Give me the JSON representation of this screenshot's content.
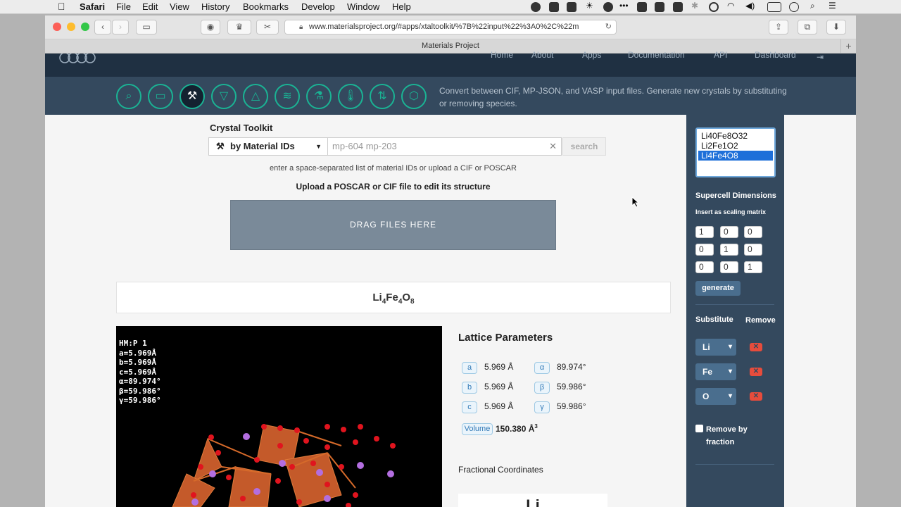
{
  "menubar": {
    "apple": "",
    "app": "Safari",
    "items": [
      "File",
      "Edit",
      "View",
      "History",
      "Bookmarks",
      "Develop",
      "Window",
      "Help"
    ]
  },
  "browser": {
    "url": "www.materialsproject.org/#apps/xtaltoolkit/%7B%22input%22%3A0%2C%22m",
    "tab_title": "Materials Project"
  },
  "site_nav": {
    "items": [
      "Home",
      "About",
      "Apps",
      "Documentation",
      "API",
      "Dashboard"
    ]
  },
  "app_toolbar": {
    "icons": [
      "search-icon",
      "battery-icon",
      "tools-icon",
      "phase-icon",
      "diagram-icon",
      "bands-icon",
      "flask-icon",
      "thermometer-icon",
      "exchange-icon",
      "structure-icon"
    ],
    "description": "Convert between CIF, MP-JSON, and VASP input files. Generate new crystals by substituting or removing species."
  },
  "toolkit": {
    "title": "Crystal Toolkit",
    "dropdown_label": "by Material IDs",
    "search_placeholder": "mp-604 mp-203",
    "search_button": "search",
    "hint": "enter a space-separated list of material IDs or upload a CIF or POSCAR",
    "upload_title": "Upload a POSCAR or CIF file to edit its structure",
    "drop_label": "DRAG FILES HERE"
  },
  "structure": {
    "formula_elements": [
      {
        "el": "Li",
        "n": "4"
      },
      {
        "el": "Fe",
        "n": "4"
      },
      {
        "el": "O",
        "n": "8"
      }
    ],
    "viewer_text": "HM:P 1\na=5.969Å\nb=5.969Å\nc=5.969Å\nα=89.974°\nβ=59.986°\nγ=59.986°"
  },
  "lattice": {
    "title": "Lattice Parameters",
    "params": [
      {
        "sym": "a",
        "val": "5.969 Å",
        "angle_sym": "α",
        "angle_val": "89.974°"
      },
      {
        "sym": "b",
        "val": "5.969 Å",
        "angle_sym": "β",
        "angle_val": "59.986°"
      },
      {
        "sym": "c",
        "val": "5.969 Å",
        "angle_sym": "γ",
        "angle_val": "59.986°"
      }
    ],
    "volume_label": "Volume",
    "volume_value": "150.380 Å",
    "volume_exp": "3",
    "fractional_title": "Fractional Coordinates",
    "first_species": "Li"
  },
  "sidebar": {
    "history": [
      "Li40Fe8O32",
      "Li2Fe1O2",
      "Li4Fe4O8"
    ],
    "supercell_title": "Supercell Dimensions",
    "supercell_hint": "Insert as scaling matrix",
    "matrix": [
      [
        "1",
        "0",
        "0"
      ],
      [
        "0",
        "1",
        "0"
      ],
      [
        "0",
        "0",
        "1"
      ]
    ],
    "generate_label": "generate",
    "substitute_label": "Substitute",
    "remove_label": "Remove",
    "elements": [
      "Li",
      "Fe",
      "O"
    ],
    "remove_fraction_label": "Remove by fraction"
  },
  "colors": {
    "accent": "#1ab394",
    "nav_dark": "#1f3042",
    "app_bar": "#34495e"
  }
}
